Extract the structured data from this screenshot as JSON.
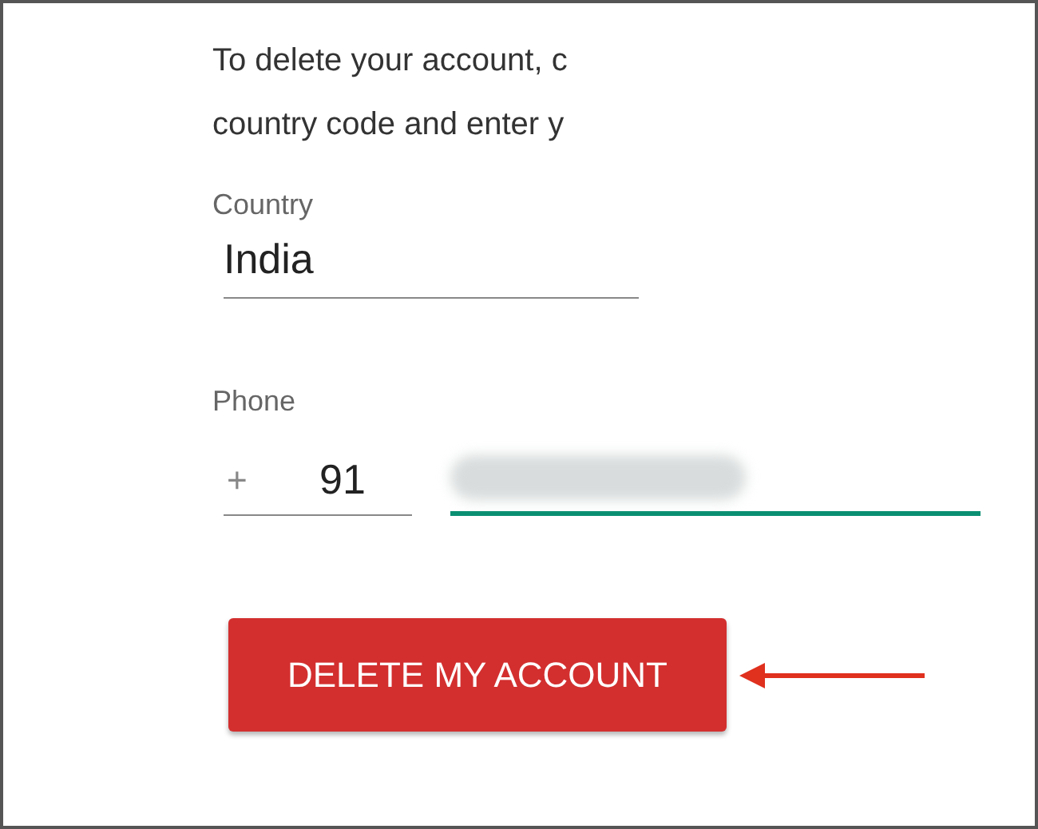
{
  "instructions": [
    "To delete your account, c",
    "country code and enter y"
  ],
  "country": {
    "label": "Country",
    "value": "India"
  },
  "phone": {
    "label": "Phone",
    "prefix": "+",
    "code": "91",
    "number_focused": true
  },
  "button": {
    "label": "DELETE MY ACCOUNT"
  },
  "annotation": {
    "kind": "arrow"
  }
}
